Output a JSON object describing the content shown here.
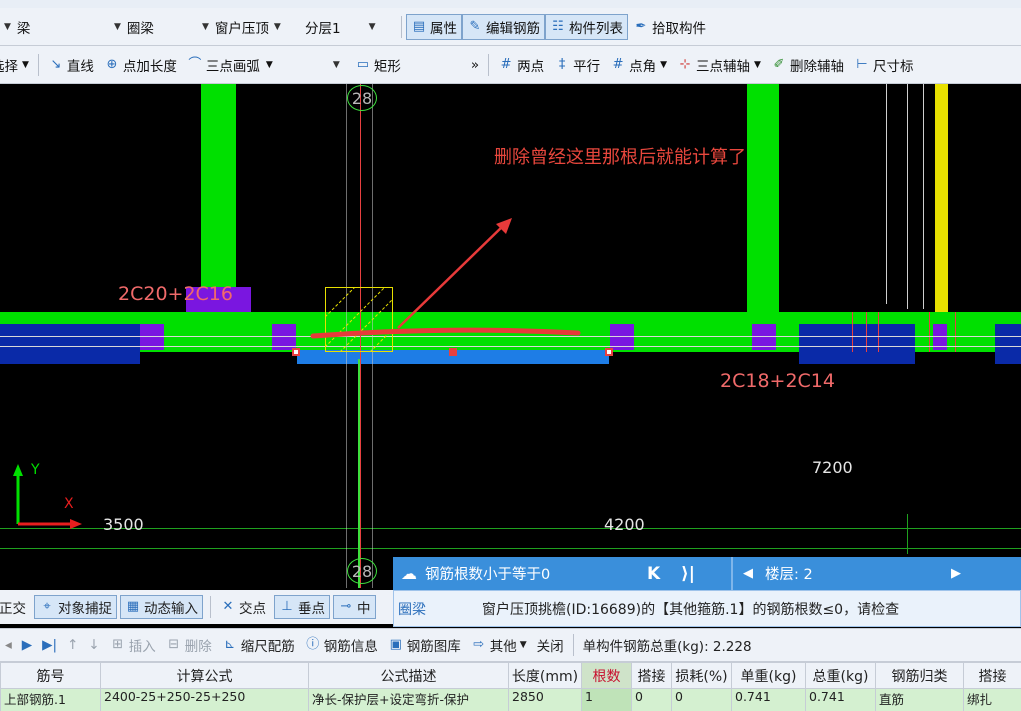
{
  "toolbar_top": {
    "combo_type": "梁",
    "combo_category": "圈梁",
    "combo_component": "窗户压顶",
    "combo_layer": "分层1",
    "btn_properties": "属性",
    "btn_edit_rebar": "编辑钢筋",
    "btn_component_list": "构件列表",
    "btn_pick_component": "拾取构件"
  },
  "toolbar_draw": {
    "select_label": "选择",
    "line": "直线",
    "point_length": "点加长度",
    "three_point_arc": "三点画弧",
    "rect": "矩形",
    "more": "»",
    "two_points": "两点",
    "parallel": "平行",
    "point_angle": "点角",
    "three_point_axis": "三点辅轴",
    "delete_axis": "删除辅轴",
    "dimension": "尺寸标"
  },
  "canvas": {
    "axis_top": "28",
    "axis_bottom": "28",
    "annotation": "删除曾经这里那根后就能计算了",
    "label_top_rebar": "2C20+2C16",
    "label_bottom_rebar": "2C18+2C14",
    "dim_3500": "3500",
    "dim_4200": "4200",
    "dim_7200": "7200",
    "axis_y": "Y",
    "axis_x": "X"
  },
  "snapbar": {
    "ortho": "正交",
    "object_snap": "对象捕捉",
    "dynamic_input": "动态输入",
    "intersection": "交点",
    "perpendicular": "垂点",
    "midpoint": "中"
  },
  "notice": {
    "title": "钢筋根数小于等于0",
    "nav_first": "K",
    "nav_last": "⟩|",
    "floor_label": "楼层: 2",
    "component": "圈梁",
    "message": "窗户压顶挑檐(ID:16689)的【其他箍筋.1】的钢筋根数≤0，请检查"
  },
  "editor_toolbar": {
    "insert": "插入",
    "delete": "删除",
    "scale_rebar": "缩尺配筋",
    "rebar_info": "钢筋信息",
    "rebar_library": "钢筋图库",
    "other": "其他",
    "close": "关闭",
    "total_weight": "单构件钢筋总重(kg): 2.228"
  },
  "table": {
    "headers": [
      "筋号",
      "计算公式",
      "公式描述",
      "长度(mm)",
      "根数",
      "搭接",
      "损耗(%)",
      "单重(kg)",
      "总重(kg)",
      "钢筋归类",
      "搭接"
    ],
    "rows": [
      [
        "上部钢筋.1",
        "2400-25+250-25+250",
        "净长-保护层+设定弯折-保护",
        "2850",
        "1",
        "0",
        "0",
        "0.741",
        "0.741",
        "直筋",
        "绑扎"
      ]
    ]
  },
  "colors": {
    "canvas_bg": "#000000",
    "beam_green": "#00e000",
    "column_purple": "#7a16e0",
    "slab_blue": "#0a2aa8",
    "sill_blue": "#1e7de6",
    "annotation_red": "#e83a3a",
    "axis_red": "#e84040",
    "highlight_yellow": "#e8e000",
    "notice_blue": "#3a8fdb"
  }
}
